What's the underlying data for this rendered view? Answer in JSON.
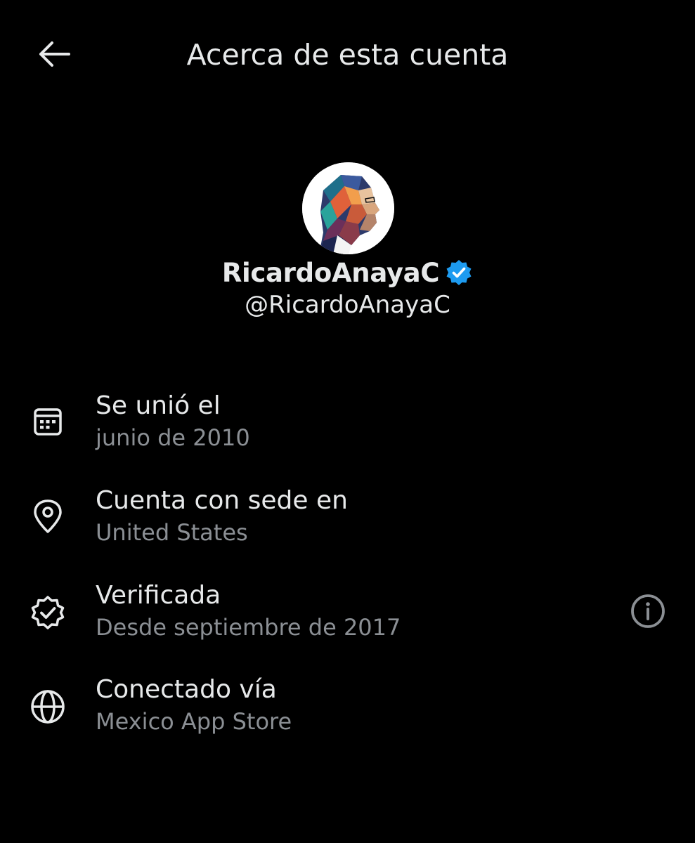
{
  "header": {
    "title": "Acerca de esta cuenta",
    "back_icon": "arrow-left-icon"
  },
  "profile": {
    "display_name": "RicardoAnayaC",
    "handle": "@RicardoAnayaC",
    "verified": true,
    "verified_color": "#1d9bf0"
  },
  "rows": [
    {
      "icon": "calendar-icon",
      "label": "Se unió el",
      "value": "junio de 2010"
    },
    {
      "icon": "location-pin-icon",
      "label": "Cuenta con sede en",
      "value": "United States"
    },
    {
      "icon": "verified-check-icon",
      "label": "Verificada",
      "value": "Desde septiembre de 2017",
      "action_icon": "info-icon"
    },
    {
      "icon": "globe-icon",
      "label": "Conectado vía",
      "value": "Mexico App Store"
    }
  ],
  "colors": {
    "background": "#000000",
    "primary_text": "#e7e9ea",
    "secondary_text": "#8b8f94",
    "accent": "#1d9bf0"
  }
}
